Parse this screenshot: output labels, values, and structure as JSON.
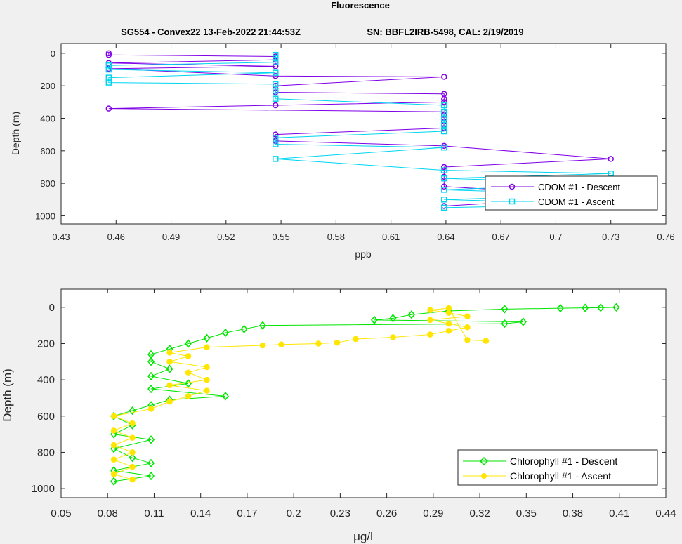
{
  "figure": {
    "title": "Fluorescence",
    "subtitle_left": "SG554 - Convex22 13-Feb-2022 21:44:53Z",
    "subtitle_right": "SN: BBFL2IRB-5498, CAL: 2/19/2019",
    "background": "#f0f0f0"
  },
  "chart_data": [
    {
      "type": "line",
      "xlabel": "ppb",
      "ylabel": "Depth (m)",
      "xlim": [
        0.43,
        0.76
      ],
      "ylim": [
        1050,
        -60
      ],
      "y_reversed": true,
      "xticks": [
        "0.43",
        "0.46",
        "0.49",
        "0.52",
        "0.55",
        "0.58",
        "0.61",
        "0.64",
        "0.67",
        "0.7",
        "0.73",
        "0.76"
      ],
      "yticks": [
        "0",
        "200",
        "400",
        "600",
        "800",
        "1000"
      ],
      "grid": false,
      "legend_position": "bottom-right",
      "series": [
        {
          "name": "CDOM #1 - Descent",
          "color": "#7f00e6",
          "marker": "circle",
          "points": [
            [
              0.456,
              0
            ],
            [
              0.456,
              10
            ],
            [
              0.547,
              20
            ],
            [
              0.547,
              40
            ],
            [
              0.456,
              60
            ],
            [
              0.547,
              80
            ],
            [
              0.456,
              95
            ],
            [
              0.547,
              140
            ],
            [
              0.639,
              145
            ],
            [
              0.547,
              200
            ],
            [
              0.547,
              240
            ],
            [
              0.639,
              250
            ],
            [
              0.639,
              280
            ],
            [
              0.639,
              300
            ],
            [
              0.547,
              320
            ],
            [
              0.456,
              340
            ],
            [
              0.639,
              360
            ],
            [
              0.639,
              380
            ],
            [
              0.639,
              400
            ],
            [
              0.639,
              420
            ],
            [
              0.639,
              440
            ],
            [
              0.639,
              460
            ],
            [
              0.547,
              500
            ],
            [
              0.547,
              540
            ],
            [
              0.639,
              570
            ],
            [
              0.73,
              650
            ],
            [
              0.639,
              700
            ],
            [
              0.639,
              760
            ],
            [
              0.639,
              820
            ],
            [
              0.73,
              880
            ],
            [
              0.639,
              940
            ]
          ]
        },
        {
          "name": "CDOM #1 - Ascent",
          "color": "#00d5f0",
          "marker": "square",
          "points": [
            [
              0.639,
              950
            ],
            [
              0.73,
              930
            ],
            [
              0.639,
              900
            ],
            [
              0.73,
              870
            ],
            [
              0.639,
              840
            ],
            [
              0.73,
              800
            ],
            [
              0.639,
              770
            ],
            [
              0.73,
              740
            ],
            [
              0.639,
              720
            ],
            [
              0.547,
              650
            ],
            [
              0.639,
              580
            ],
            [
              0.547,
              560
            ],
            [
              0.547,
              520
            ],
            [
              0.639,
              480
            ],
            [
              0.639,
              440
            ],
            [
              0.639,
              400
            ],
            [
              0.639,
              360
            ],
            [
              0.639,
              320
            ],
            [
              0.547,
              280
            ],
            [
              0.547,
              230
            ],
            [
              0.547,
              190
            ],
            [
              0.456,
              180
            ],
            [
              0.456,
              150
            ],
            [
              0.547,
              120
            ],
            [
              0.456,
              100
            ],
            [
              0.456,
              75
            ],
            [
              0.547,
              55
            ],
            [
              0.547,
              30
            ],
            [
              0.547,
              10
            ]
          ]
        }
      ]
    },
    {
      "type": "line",
      "xlabel": "μg/l",
      "ylabel": "Depth (m)",
      "xlim": [
        0.05,
        0.44
      ],
      "ylim": [
        1050,
        -100
      ],
      "y_reversed": true,
      "xticks": [
        "0.05",
        "0.08",
        "0.11",
        "0.14",
        "0.17",
        "0.2",
        "0.23",
        "0.26",
        "0.29",
        "0.32",
        "0.35",
        "0.38",
        "0.41",
        "0.44"
      ],
      "yticks": [
        "0",
        "200",
        "400",
        "600",
        "800",
        "1000"
      ],
      "grid": false,
      "legend_position": "bottom-right",
      "series": [
        {
          "name": "Chlorophyll #1 - Descent",
          "color": "#00e600",
          "marker": "diamond",
          "points": [
            [
              0.408,
              0
            ],
            [
              0.398,
              2
            ],
            [
              0.388,
              3
            ],
            [
              0.372,
              5
            ],
            [
              0.336,
              10
            ],
            [
              0.3,
              20
            ],
            [
              0.276,
              40
            ],
            [
              0.264,
              60
            ],
            [
              0.252,
              70
            ],
            [
              0.348,
              80
            ],
            [
              0.336,
              90
            ],
            [
              0.18,
              100
            ],
            [
              0.168,
              120
            ],
            [
              0.156,
              140
            ],
            [
              0.144,
              170
            ],
            [
              0.132,
              200
            ],
            [
              0.12,
              230
            ],
            [
              0.108,
              260
            ],
            [
              0.108,
              300
            ],
            [
              0.12,
              340
            ],
            [
              0.108,
              380
            ],
            [
              0.132,
              420
            ],
            [
              0.108,
              450
            ],
            [
              0.156,
              490
            ],
            [
              0.12,
              510
            ],
            [
              0.108,
              540
            ],
            [
              0.096,
              570
            ],
            [
              0.084,
              600
            ],
            [
              0.096,
              650
            ],
            [
              0.084,
              700
            ],
            [
              0.108,
              730
            ],
            [
              0.084,
              780
            ],
            [
              0.096,
              830
            ],
            [
              0.108,
              860
            ],
            [
              0.084,
              900
            ],
            [
              0.108,
              930
            ],
            [
              0.084,
              960
            ]
          ]
        },
        {
          "name": "Chlorophyll #1 - Ascent",
          "color": "#ffe600",
          "marker": "circle",
          "points": [
            [
              0.096,
              950
            ],
            [
              0.084,
              920
            ],
            [
              0.096,
              880
            ],
            [
              0.084,
              840
            ],
            [
              0.096,
              800
            ],
            [
              0.084,
              760
            ],
            [
              0.096,
              720
            ],
            [
              0.084,
              680
            ],
            [
              0.096,
              640
            ],
            [
              0.084,
              600
            ],
            [
              0.108,
              560
            ],
            [
              0.12,
              520
            ],
            [
              0.132,
              490
            ],
            [
              0.144,
              460
            ],
            [
              0.12,
              430
            ],
            [
              0.144,
              400
            ],
            [
              0.132,
              360
            ],
            [
              0.144,
              330
            ],
            [
              0.12,
              300
            ],
            [
              0.132,
              270
            ],
            [
              0.12,
              250
            ],
            [
              0.144,
              220
            ],
            [
              0.18,
              210
            ],
            [
              0.192,
              205
            ],
            [
              0.216,
              200
            ],
            [
              0.228,
              195
            ],
            [
              0.24,
              175
            ],
            [
              0.264,
              165
            ],
            [
              0.288,
              150
            ],
            [
              0.3,
              130
            ],
            [
              0.312,
              110
            ],
            [
              0.3,
              90
            ],
            [
              0.288,
              70
            ],
            [
              0.312,
              50
            ],
            [
              0.3,
              30
            ],
            [
              0.288,
              15
            ],
            [
              0.3,
              5
            ],
            [
              0.312,
              180
            ],
            [
              0.324,
              185
            ]
          ]
        }
      ]
    }
  ]
}
